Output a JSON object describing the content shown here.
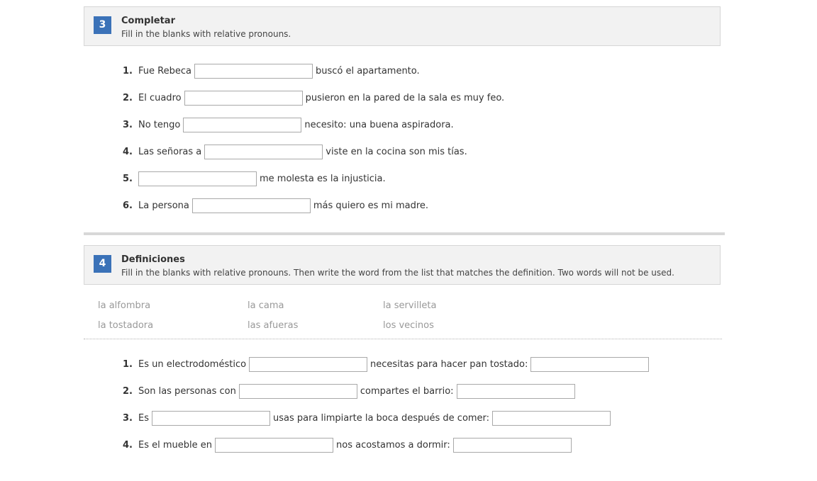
{
  "section3": {
    "number": "3",
    "title": "Completar",
    "instructions": "Fill in the blanks with relative pronouns.",
    "items": [
      {
        "num": "1.",
        "before": "Fue Rebeca",
        "after": "buscó el apartamento."
      },
      {
        "num": "2.",
        "before": "El cuadro",
        "after": "pusieron en la pared de la sala es muy feo."
      },
      {
        "num": "3.",
        "before": "No tengo",
        "after": "necesito: una buena aspiradora."
      },
      {
        "num": "4.",
        "before": "Las señoras a",
        "after": "viste en la cocina son mis tías."
      },
      {
        "num": "5.",
        "before": "",
        "after": "me molesta es la injusticia."
      },
      {
        "num": "6.",
        "before": "La persona",
        "after": "más quiero es mi madre."
      }
    ]
  },
  "section4": {
    "number": "4",
    "title": "Definiciones",
    "instructions": "Fill in the blanks with relative pronouns. Then write the word from the list that matches the definition. Two words will not be used.",
    "word_bank": [
      "la alfombra",
      "la cama",
      "la servilleta",
      "la tostadora",
      "las afueras",
      "los vecinos"
    ],
    "items": [
      {
        "num": "1.",
        "before": "Es un electrodoméstico",
        "middle": "necesitas para hacer pan tostado:"
      },
      {
        "num": "2.",
        "before": "Son las personas con",
        "middle": "compartes el barrio:"
      },
      {
        "num": "3.",
        "before": "Es",
        "middle": "usas para limpiarte la boca después de comer:"
      },
      {
        "num": "4.",
        "before": "Es el mueble en",
        "middle": "nos acostamos a dormir:"
      }
    ]
  },
  "colors": {
    "badge": "#3b72b8",
    "header_bg": "#f2f2f2",
    "word_bank_text": "#999999"
  }
}
